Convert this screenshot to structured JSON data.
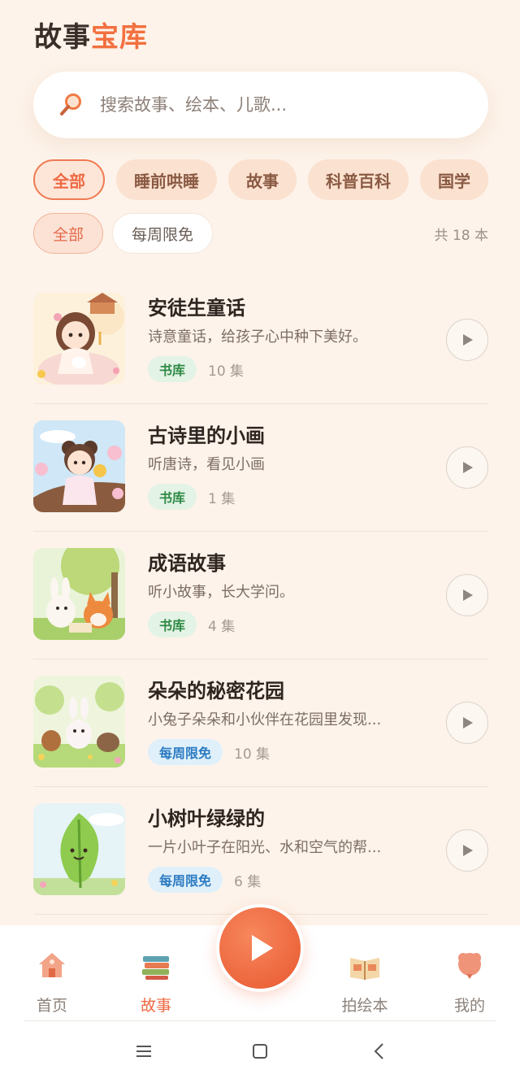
{
  "header": {
    "title_main": "故事",
    "title_accent": "宝库"
  },
  "search": {
    "placeholder": "搜索故事、绘本、儿歌..."
  },
  "categories": [
    {
      "label": "全部"
    },
    {
      "label": "睡前哄睡"
    },
    {
      "label": "故事"
    },
    {
      "label": "科普百科"
    },
    {
      "label": "国学"
    }
  ],
  "sub_filters": {
    "all": "全部",
    "free": "每周限免",
    "count": "共 18 本"
  },
  "stories": [
    {
      "title": "安徒生童话",
      "desc": "诗意童话，给孩子心中种下美好。",
      "tag": "书库",
      "episodes": "10 集"
    },
    {
      "title": "古诗里的小画",
      "desc": "听唐诗，看见小画",
      "tag": "书库",
      "episodes": "1 集"
    },
    {
      "title": "成语故事",
      "desc": "听小故事，长大学问。",
      "tag": "书库",
      "episodes": "4 集"
    },
    {
      "title": "朵朵的秘密花园",
      "desc": "小兔子朵朵和小伙伴在花园里发现...",
      "tag": "每周限免",
      "episodes": "10 集"
    },
    {
      "title": "小树叶绿绿的",
      "desc": "一片小叶子在阳光、水和空气的帮...",
      "tag": "每周限免",
      "episodes": "6 集"
    }
  ],
  "tabbar": {
    "home": "首页",
    "stories": "故事",
    "picture_book": "拍绘本",
    "mine": "我的"
  },
  "colors": {
    "accent": "#f2703f",
    "background": "#fdf3ea",
    "library_tag": "#2f8a45",
    "free_tag": "#2c7bc1"
  }
}
